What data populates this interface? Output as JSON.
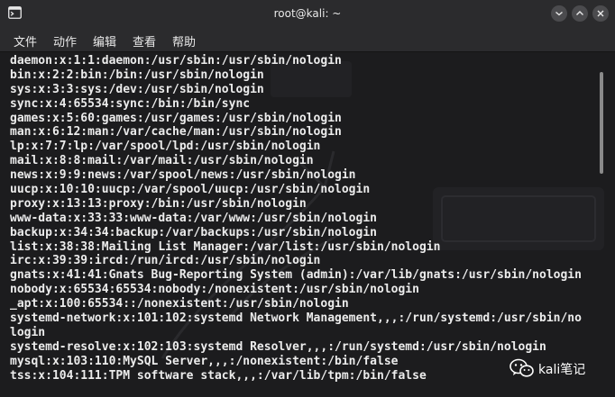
{
  "window": {
    "title": "root@kali: ~"
  },
  "icons": {
    "app": "terminal-icon",
    "minimize": "minimize-icon",
    "maximize": "maximize-icon",
    "close": "close-icon",
    "watermark": "wechat-icon"
  },
  "menu": {
    "items": [
      "文件",
      "动作",
      "编辑",
      "查看",
      "帮助"
    ]
  },
  "terminal": {
    "lines": [
      "daemon:x:1:1:daemon:/usr/sbin:/usr/sbin/nologin",
      "bin:x:2:2:bin:/bin:/usr/sbin/nologin",
      "sys:x:3:3:sys:/dev:/usr/sbin/nologin",
      "sync:x:4:65534:sync:/bin:/bin/sync",
      "games:x:5:60:games:/usr/games:/usr/sbin/nologin",
      "man:x:6:12:man:/var/cache/man:/usr/sbin/nologin",
      "lp:x:7:7:lp:/var/spool/lpd:/usr/sbin/nologin",
      "mail:x:8:8:mail:/var/mail:/usr/sbin/nologin",
      "news:x:9:9:news:/var/spool/news:/usr/sbin/nologin",
      "uucp:x:10:10:uucp:/var/spool/uucp:/usr/sbin/nologin",
      "proxy:x:13:13:proxy:/bin:/usr/sbin/nologin",
      "www-data:x:33:33:www-data:/var/www:/usr/sbin/nologin",
      "backup:x:34:34:backup:/var/backups:/usr/sbin/nologin",
      "list:x:38:38:Mailing List Manager:/var/list:/usr/sbin/nologin",
      "irc:x:39:39:ircd:/run/ircd:/usr/sbin/nologin",
      "gnats:x:41:41:Gnats Bug-Reporting System (admin):/var/lib/gnats:/usr/sbin/nologin",
      "nobody:x:65534:65534:nobody:/nonexistent:/usr/sbin/nologin",
      "_apt:x:100:65534::/nonexistent:/usr/sbin/nologin",
      "systemd-network:x:101:102:systemd Network Management,,,:/run/systemd:/usr/sbin/no",
      "login",
      "systemd-resolve:x:102:103:systemd Resolver,,,:/run/systemd:/usr/sbin/nologin",
      "mysql:x:103:110:MySQL Server,,,:/nonexistent:/bin/false",
      "tss:x:104:111:TPM software stack,,,:/var/lib/tpm:/bin/false"
    ]
  },
  "watermark": {
    "text": "kali笔记"
  },
  "colors": {
    "titlebar": "#2b2b2d",
    "terminal_bg": "#1c1c1e",
    "text": "#ececec",
    "window_button": "#4b4b4e"
  }
}
